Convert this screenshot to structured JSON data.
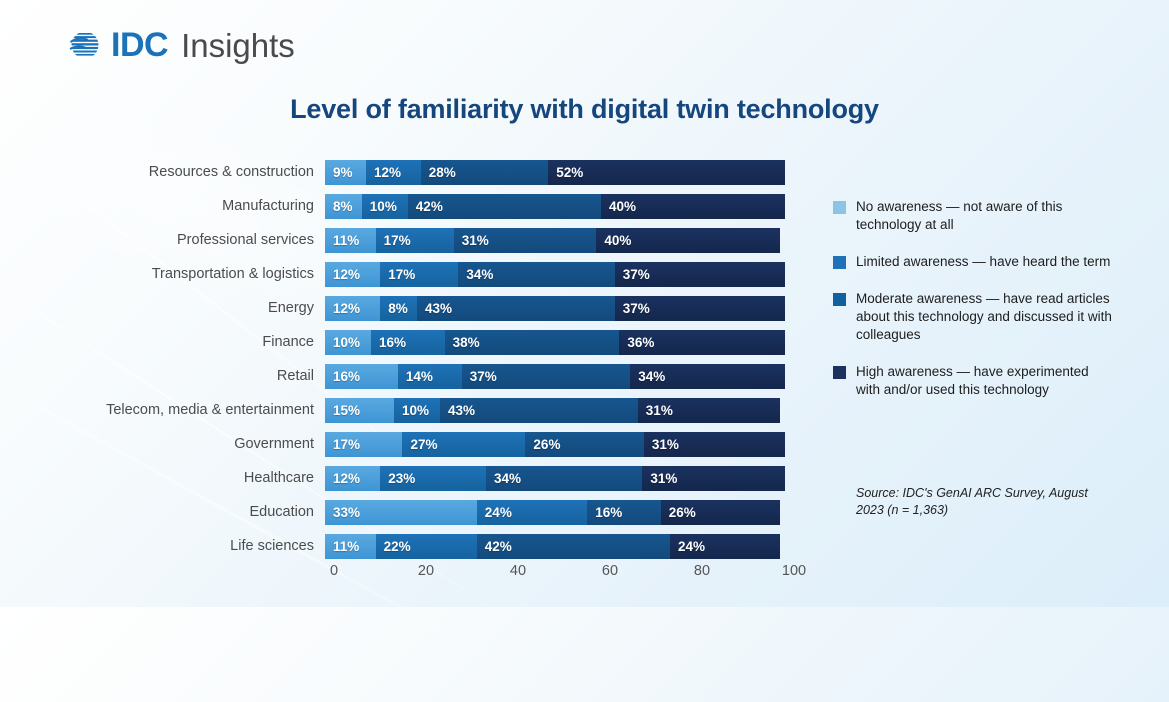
{
  "brand": {
    "logo_mark": "idc-globe-icon",
    "name": "IDC",
    "product": "Insights"
  },
  "chart_data": {
    "type": "bar",
    "orientation": "horizontal",
    "stacked": true,
    "stack_mode": "percent",
    "title": "Level of familiarity with digital twin technology",
    "xlabel": "",
    "ylabel": "",
    "xlim": [
      0,
      100
    ],
    "grid": false,
    "legend_position": "right",
    "categories": [
      "Resources & construction",
      "Manufacturing",
      "Professional services",
      "Transportation & logistics",
      "Energy",
      "Finance",
      "Retail",
      "Telecom, media & entertainment",
      "Government",
      "Healthcare",
      "Education",
      "Life sciences"
    ],
    "series": [
      {
        "name": "No awareness — not aware of this technology at all",
        "color": "#4FA3DC",
        "values": [
          9,
          8,
          11,
          12,
          12,
          10,
          16,
          15,
          17,
          12,
          33,
          11
        ],
        "labels": [
          "9%",
          "8%",
          "11%",
          "12%",
          "12%",
          "10%",
          "16%",
          "15%",
          "17%",
          "12%",
          "33%",
          "11%"
        ]
      },
      {
        "name": "Limited awareness — have heard the term",
        "color": "#1F72B8",
        "values": [
          12,
          10,
          17,
          17,
          8,
          16,
          14,
          10,
          27,
          23,
          24,
          22
        ],
        "labels": [
          "12%",
          "10%",
          "17%",
          "17%",
          "8%",
          "16%",
          "14%",
          "10%",
          "27%",
          "23%",
          "24%",
          "22%"
        ]
      },
      {
        "name": "Moderate awareness — have read articles about this technology and discussed it with colleagues",
        "color": "#17568F",
        "values": [
          28,
          42,
          31,
          34,
          43,
          38,
          37,
          43,
          26,
          34,
          16,
          42
        ],
        "labels": [
          "28%",
          "42%",
          "31%",
          "34%",
          "43%",
          "38%",
          "37%",
          "43%",
          "26%",
          "34%",
          "16%",
          "42%"
        ]
      },
      {
        "name": "High awareness — have experimented with and/or used this technology",
        "color": "#1B3260",
        "values": [
          52,
          40,
          40,
          37,
          37,
          36,
          34,
          31,
          31,
          31,
          26,
          24
        ],
        "labels": [
          "52%",
          "40%",
          "40%",
          "37%",
          "37%",
          "36%",
          "34%",
          "31%",
          "31%",
          "31%",
          "26%",
          "24%"
        ]
      }
    ],
    "xticks": [
      0,
      20,
      40,
      60,
      80,
      100
    ],
    "xtick_labels": [
      "0",
      "20",
      "40",
      "60",
      "80",
      "100"
    ],
    "source_note": "Source: IDC's GenAI ARC Survey, August 2023 (n = 1,363)"
  }
}
